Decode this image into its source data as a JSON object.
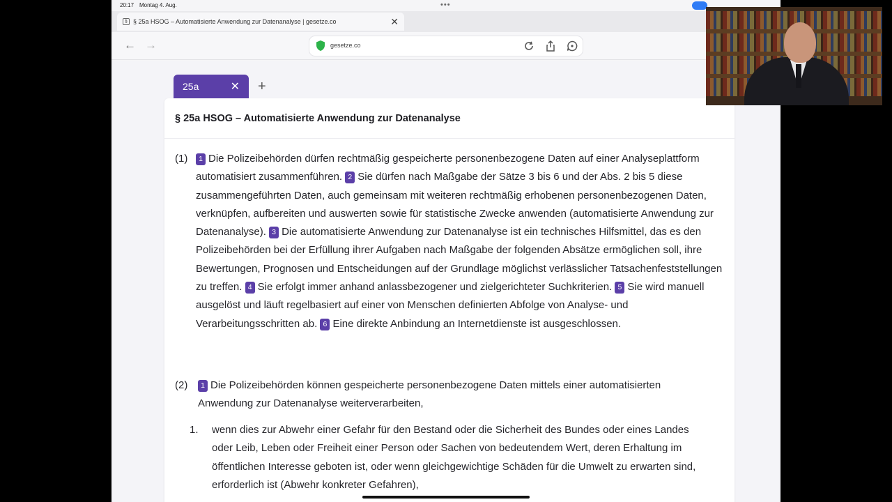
{
  "status_bar": {
    "time": "20:17",
    "date": "Montag 4. Aug.",
    "dots": "•••"
  },
  "browser": {
    "tab_title": "§ 25a HSOG – Automatisierte Anwendung zur Datenanalyse | gesetze.co",
    "favicon": "§",
    "tab_close": "✕",
    "back": "←",
    "forward": "→",
    "url": "gesetze.co"
  },
  "doc_tab": {
    "label": "25a",
    "close": "✕",
    "add": "+"
  },
  "document": {
    "title": "§ 25a HSOG – Automatisierte Anwendung zur Datenanalyse",
    "para1": {
      "num": "(1)",
      "s1_num": "1",
      "s1": "Die Polizeibehörden dürfen rechtmäßig gespeicherte personenbezogene Daten auf einer Analyseplattform automatisiert zusammenführen.",
      "s2_num": "2",
      "s2": "Sie dürfen nach Maßgabe der Sätze 3 bis 6 und der Abs. 2 bis 5 diese zusammengeführten Daten, auch gemeinsam mit weiteren rechtmäßig erhobenen personenbezogenen Daten, verknüpfen, aufbereiten und auswerten sowie für statistische Zwecke anwenden (automatisierte Anwendung zur Datenanalyse).",
      "s3_num": "3",
      "s3": "Die automatisierte Anwendung zur Datenanalyse ist ein technisches Hilfsmittel, das es den Polizeibehörden bei der Erfüllung ihrer Aufgaben nach Maßgabe der folgenden Absätze ermöglichen soll, ihre Bewertungen, Prognosen und Entscheidungen auf der Grundlage möglichst verlässlicher Tatsachenfeststellungen zu treffen.",
      "s4_num": "4",
      "s4": "Sie erfolgt immer anhand anlassbezogener und zielgerichteter Suchkriterien.",
      "s5_num": "5",
      "s5": "Sie wird manuell ausgelöst und läuft regelbasiert auf einer von Menschen definierten Abfolge von Analyse- und Verarbeitungsschritten ab.",
      "s6_num": "6",
      "s6": "Eine direkte Anbindung an Internetdienste ist ausgeschlossen."
    },
    "para2": {
      "num": "(2)",
      "s1_num": "1",
      "s1": "Die Polizeibehörden können gespeicherte personenbezogene Daten mittels einer automatisierten Anwendung zur Datenanalyse weiterverarbeiten,",
      "item1_num": "1.",
      "item1": "wenn dies zur Abwehr einer Gefahr für den Bestand oder die Sicherheit des Bundes oder eines Landes oder Leib, Leben oder Freiheit einer Person oder Sachen von bedeutendem Wert, deren Erhaltung im öffentlichen Interesse geboten ist, oder wenn gleichgewichtige Schäden für die Umwelt zu erwarten sind, erforderlich ist (Abwehr konkreter Gefahren),"
    }
  },
  "colors": {
    "accent": "#5b3fa8",
    "shield": "#2db34a",
    "status_pill": "#2f7cf6"
  }
}
